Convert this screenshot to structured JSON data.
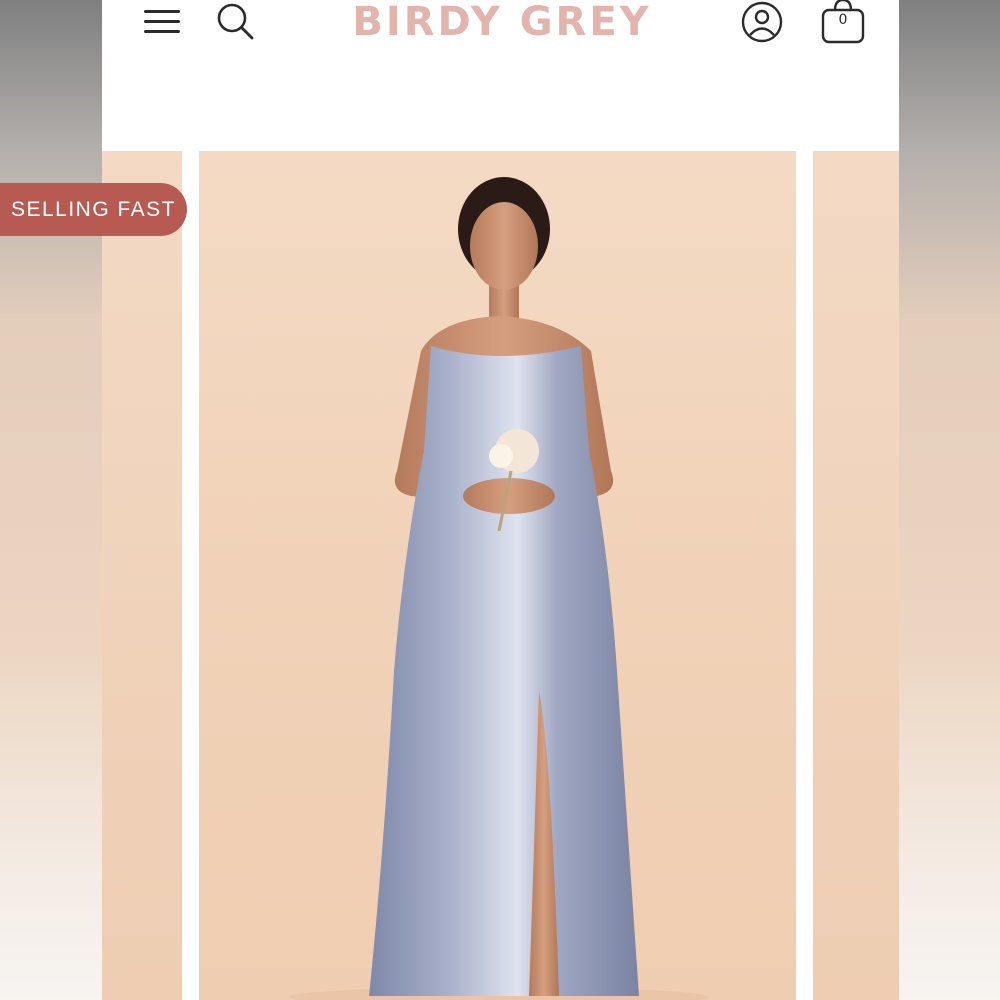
{
  "header": {
    "brand": "BIRDY GREY",
    "cart_count": "0",
    "icons": [
      "menu-icon",
      "search-icon",
      "account-icon",
      "shopping-bag-icon"
    ]
  },
  "product": {
    "badge": "SELLING FAST"
  },
  "colors": {
    "brand": "#e2b4ab",
    "badge": "#b65a52",
    "backdrop": "#f1d2b8",
    "dress": "#9aa2bd"
  }
}
